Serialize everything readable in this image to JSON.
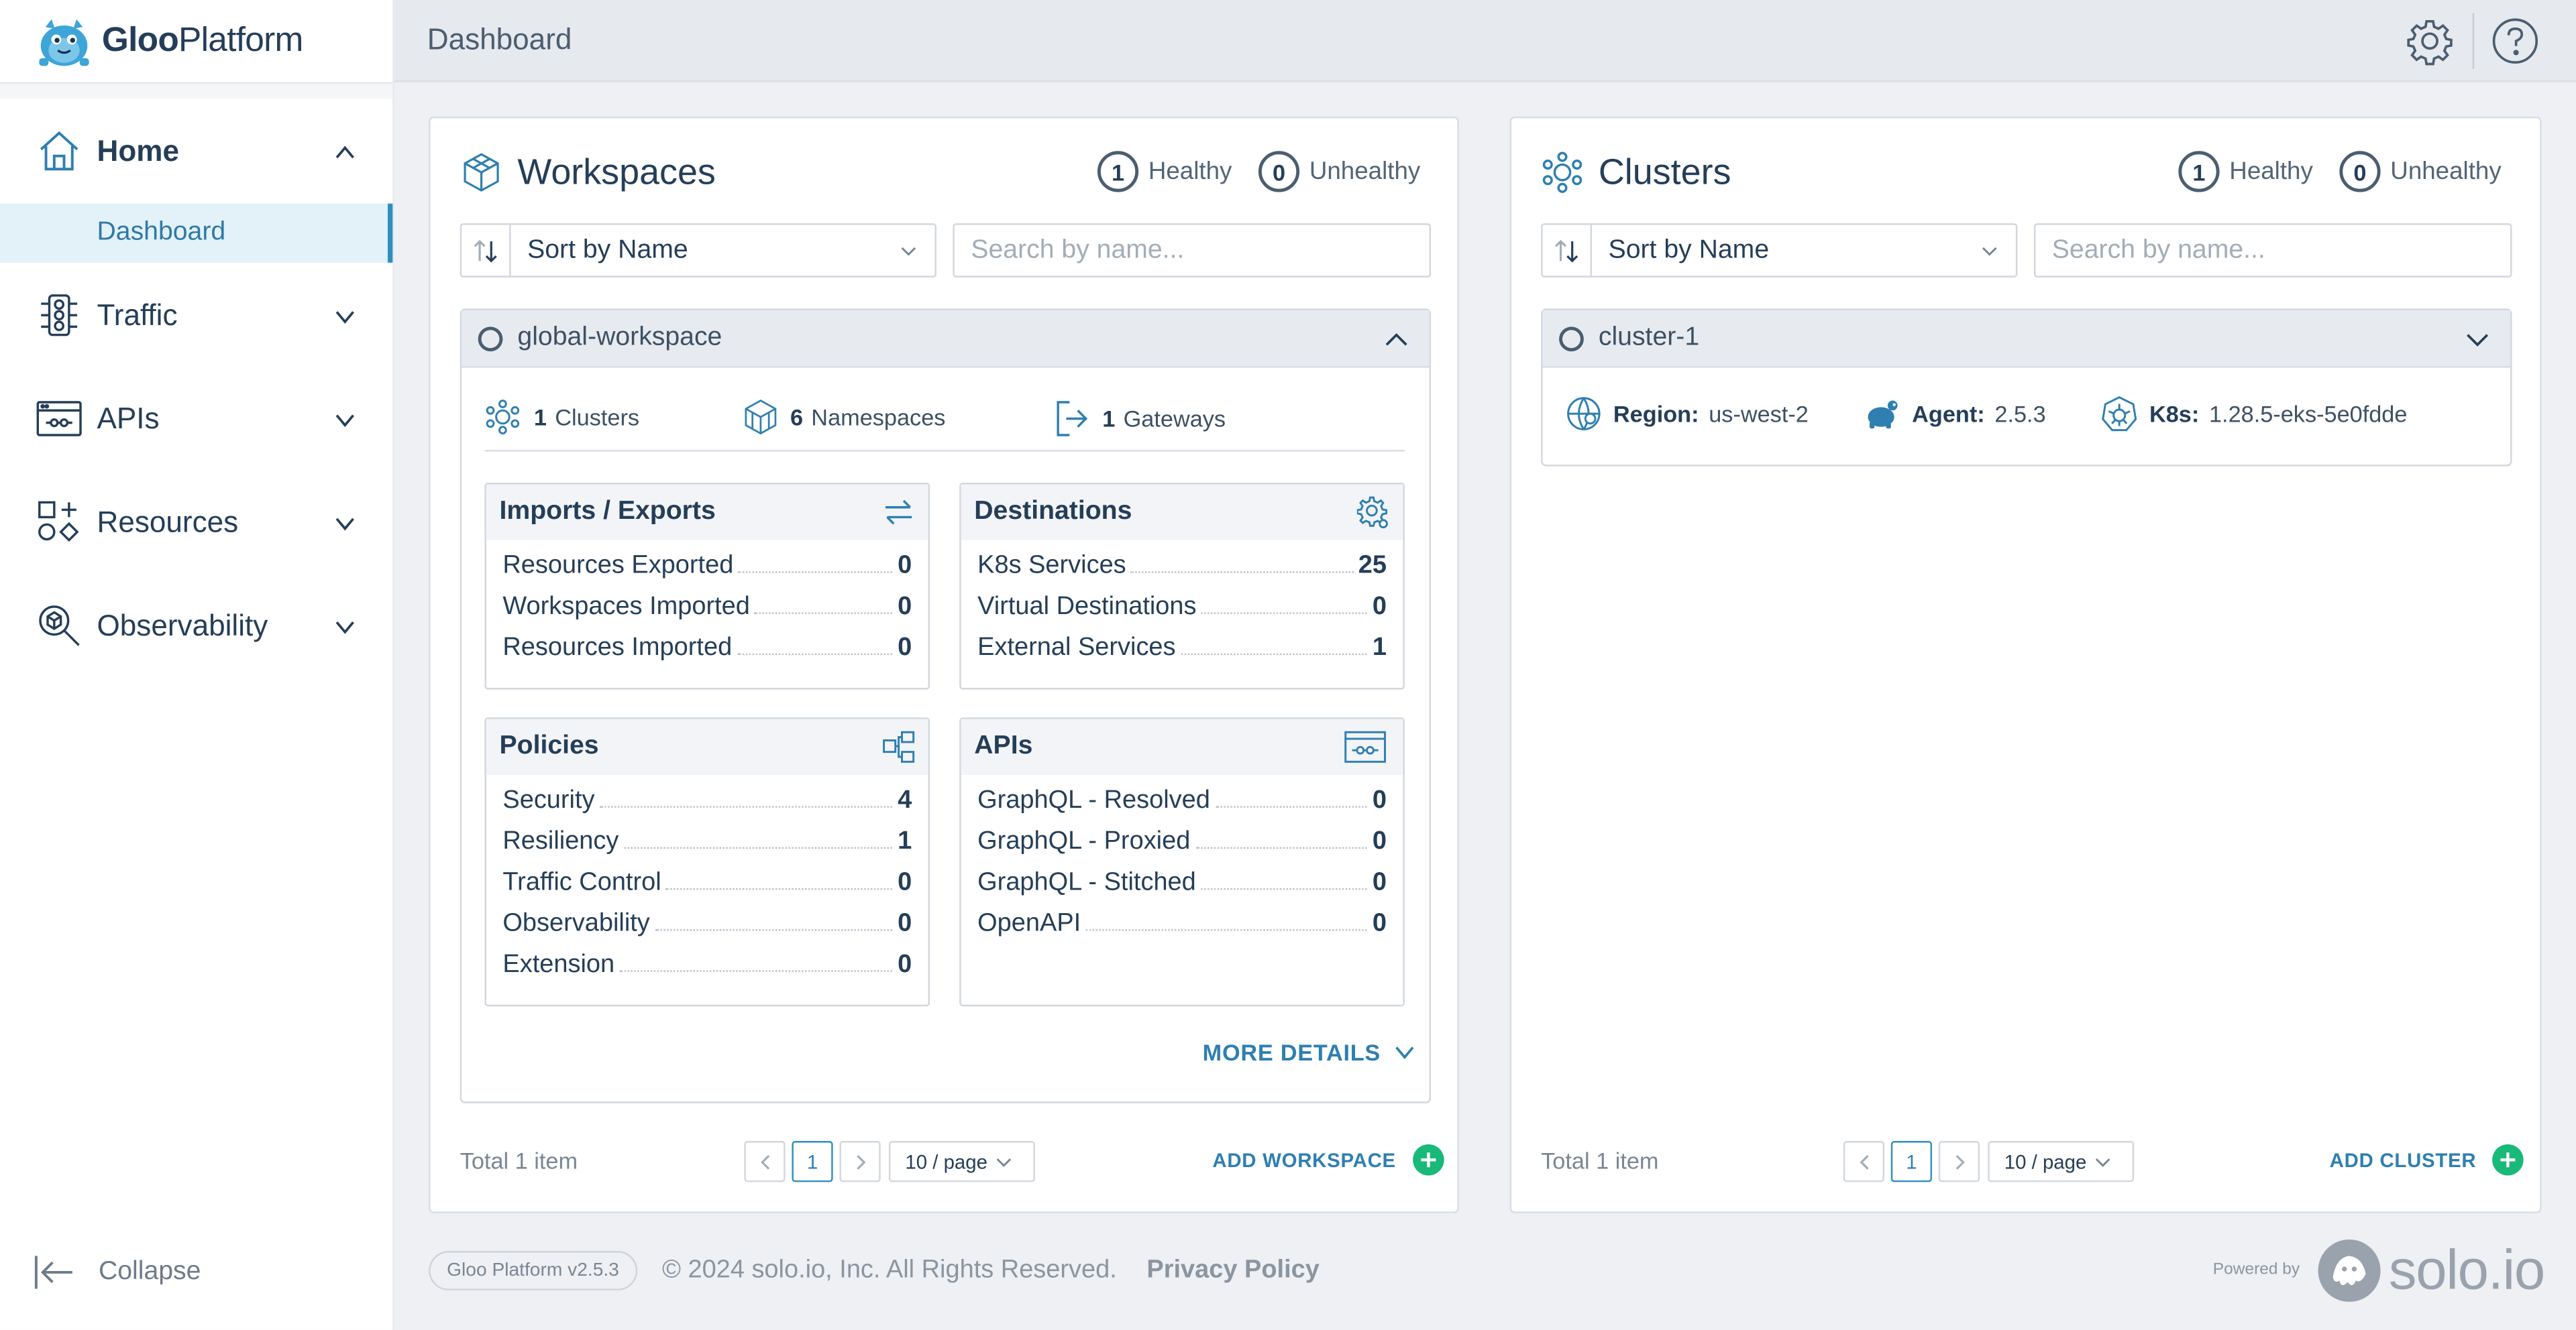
{
  "app": {
    "logo_text_bold": "Gloo",
    "logo_text_light": "Platform"
  },
  "sidebar": {
    "items": [
      {
        "label": "Home",
        "icon": "home-icon",
        "expanded": true
      },
      {
        "label": "Traffic",
        "icon": "traffic-light-icon",
        "expanded": false
      },
      {
        "label": "APIs",
        "icon": "api-icon",
        "expanded": false
      },
      {
        "label": "Resources",
        "icon": "resources-icon",
        "expanded": false
      },
      {
        "label": "Observability",
        "icon": "observability-icon",
        "expanded": false
      }
    ],
    "sub_item": "Dashboard",
    "collapse_label": "Collapse"
  },
  "header": {
    "title": "Dashboard"
  },
  "workspaces": {
    "title": "Workspaces",
    "healthy_count": "1",
    "healthy_label": "Healthy",
    "unhealthy_count": "0",
    "unhealthy_label": "Unhealthy",
    "sort_label": "Sort by Name",
    "search_placeholder": "Search by name...",
    "card": {
      "name": "global-workspace",
      "stats": {
        "clusters_count": "1",
        "clusters_label": "Clusters",
        "namespaces_count": "6",
        "namespaces_label": "Namespaces",
        "gateways_count": "1",
        "gateways_label": "Gateways"
      },
      "imports_exports": {
        "title": "Imports / Exports",
        "rows": [
          {
            "label": "Resources Exported",
            "value": "0"
          },
          {
            "label": "Workspaces Imported",
            "value": "0"
          },
          {
            "label": "Resources Imported",
            "value": "0"
          }
        ]
      },
      "destinations": {
        "title": "Destinations",
        "rows": [
          {
            "label": "K8s Services",
            "value": "25"
          },
          {
            "label": "Virtual Destinations",
            "value": "0"
          },
          {
            "label": "External Services",
            "value": "1"
          }
        ]
      },
      "policies": {
        "title": "Policies",
        "rows": [
          {
            "label": "Security",
            "value": "4"
          },
          {
            "label": "Resiliency",
            "value": "1"
          },
          {
            "label": "Traffic Control",
            "value": "0"
          },
          {
            "label": "Observability",
            "value": "0"
          },
          {
            "label": "Extension",
            "value": "0"
          }
        ]
      },
      "apis": {
        "title": "APIs",
        "rows": [
          {
            "label": "GraphQL - Resolved",
            "value": "0"
          },
          {
            "label": "GraphQL - Proxied",
            "value": "0"
          },
          {
            "label": "GraphQL - Stitched",
            "value": "0"
          },
          {
            "label": "OpenAPI",
            "value": "0"
          }
        ]
      },
      "more_details": "MORE DETAILS"
    },
    "total": "Total 1 item",
    "page": "1",
    "per_page": "10 / page",
    "add_label": "ADD WORKSPACE"
  },
  "clusters": {
    "title": "Clusters",
    "healthy_count": "1",
    "healthy_label": "Healthy",
    "unhealthy_count": "0",
    "unhealthy_label": "Unhealthy",
    "sort_label": "Sort by Name",
    "search_placeholder": "Search by name...",
    "card": {
      "name": "cluster-1",
      "region_label": "Region:",
      "region_value": "us-west-2",
      "agent_label": "Agent:",
      "agent_value": "2.5.3",
      "k8s_label": "K8s:",
      "k8s_value": "1.28.5-eks-5e0fdde"
    },
    "total": "Total 1 item",
    "page": "1",
    "per_page": "10 / page",
    "add_label": "ADD CLUSTER"
  },
  "footer": {
    "version": "Gloo Platform v2.5.3",
    "copyright": "© 2024 solo.io, Inc. All Rights Reserved.",
    "privacy": "Privacy Policy",
    "powered_by": "Powered by",
    "brand": "solo.io"
  },
  "colors": {
    "accent": "#2f7fb0",
    "add_green": "#19b97a",
    "text_dark": "#253e58"
  }
}
